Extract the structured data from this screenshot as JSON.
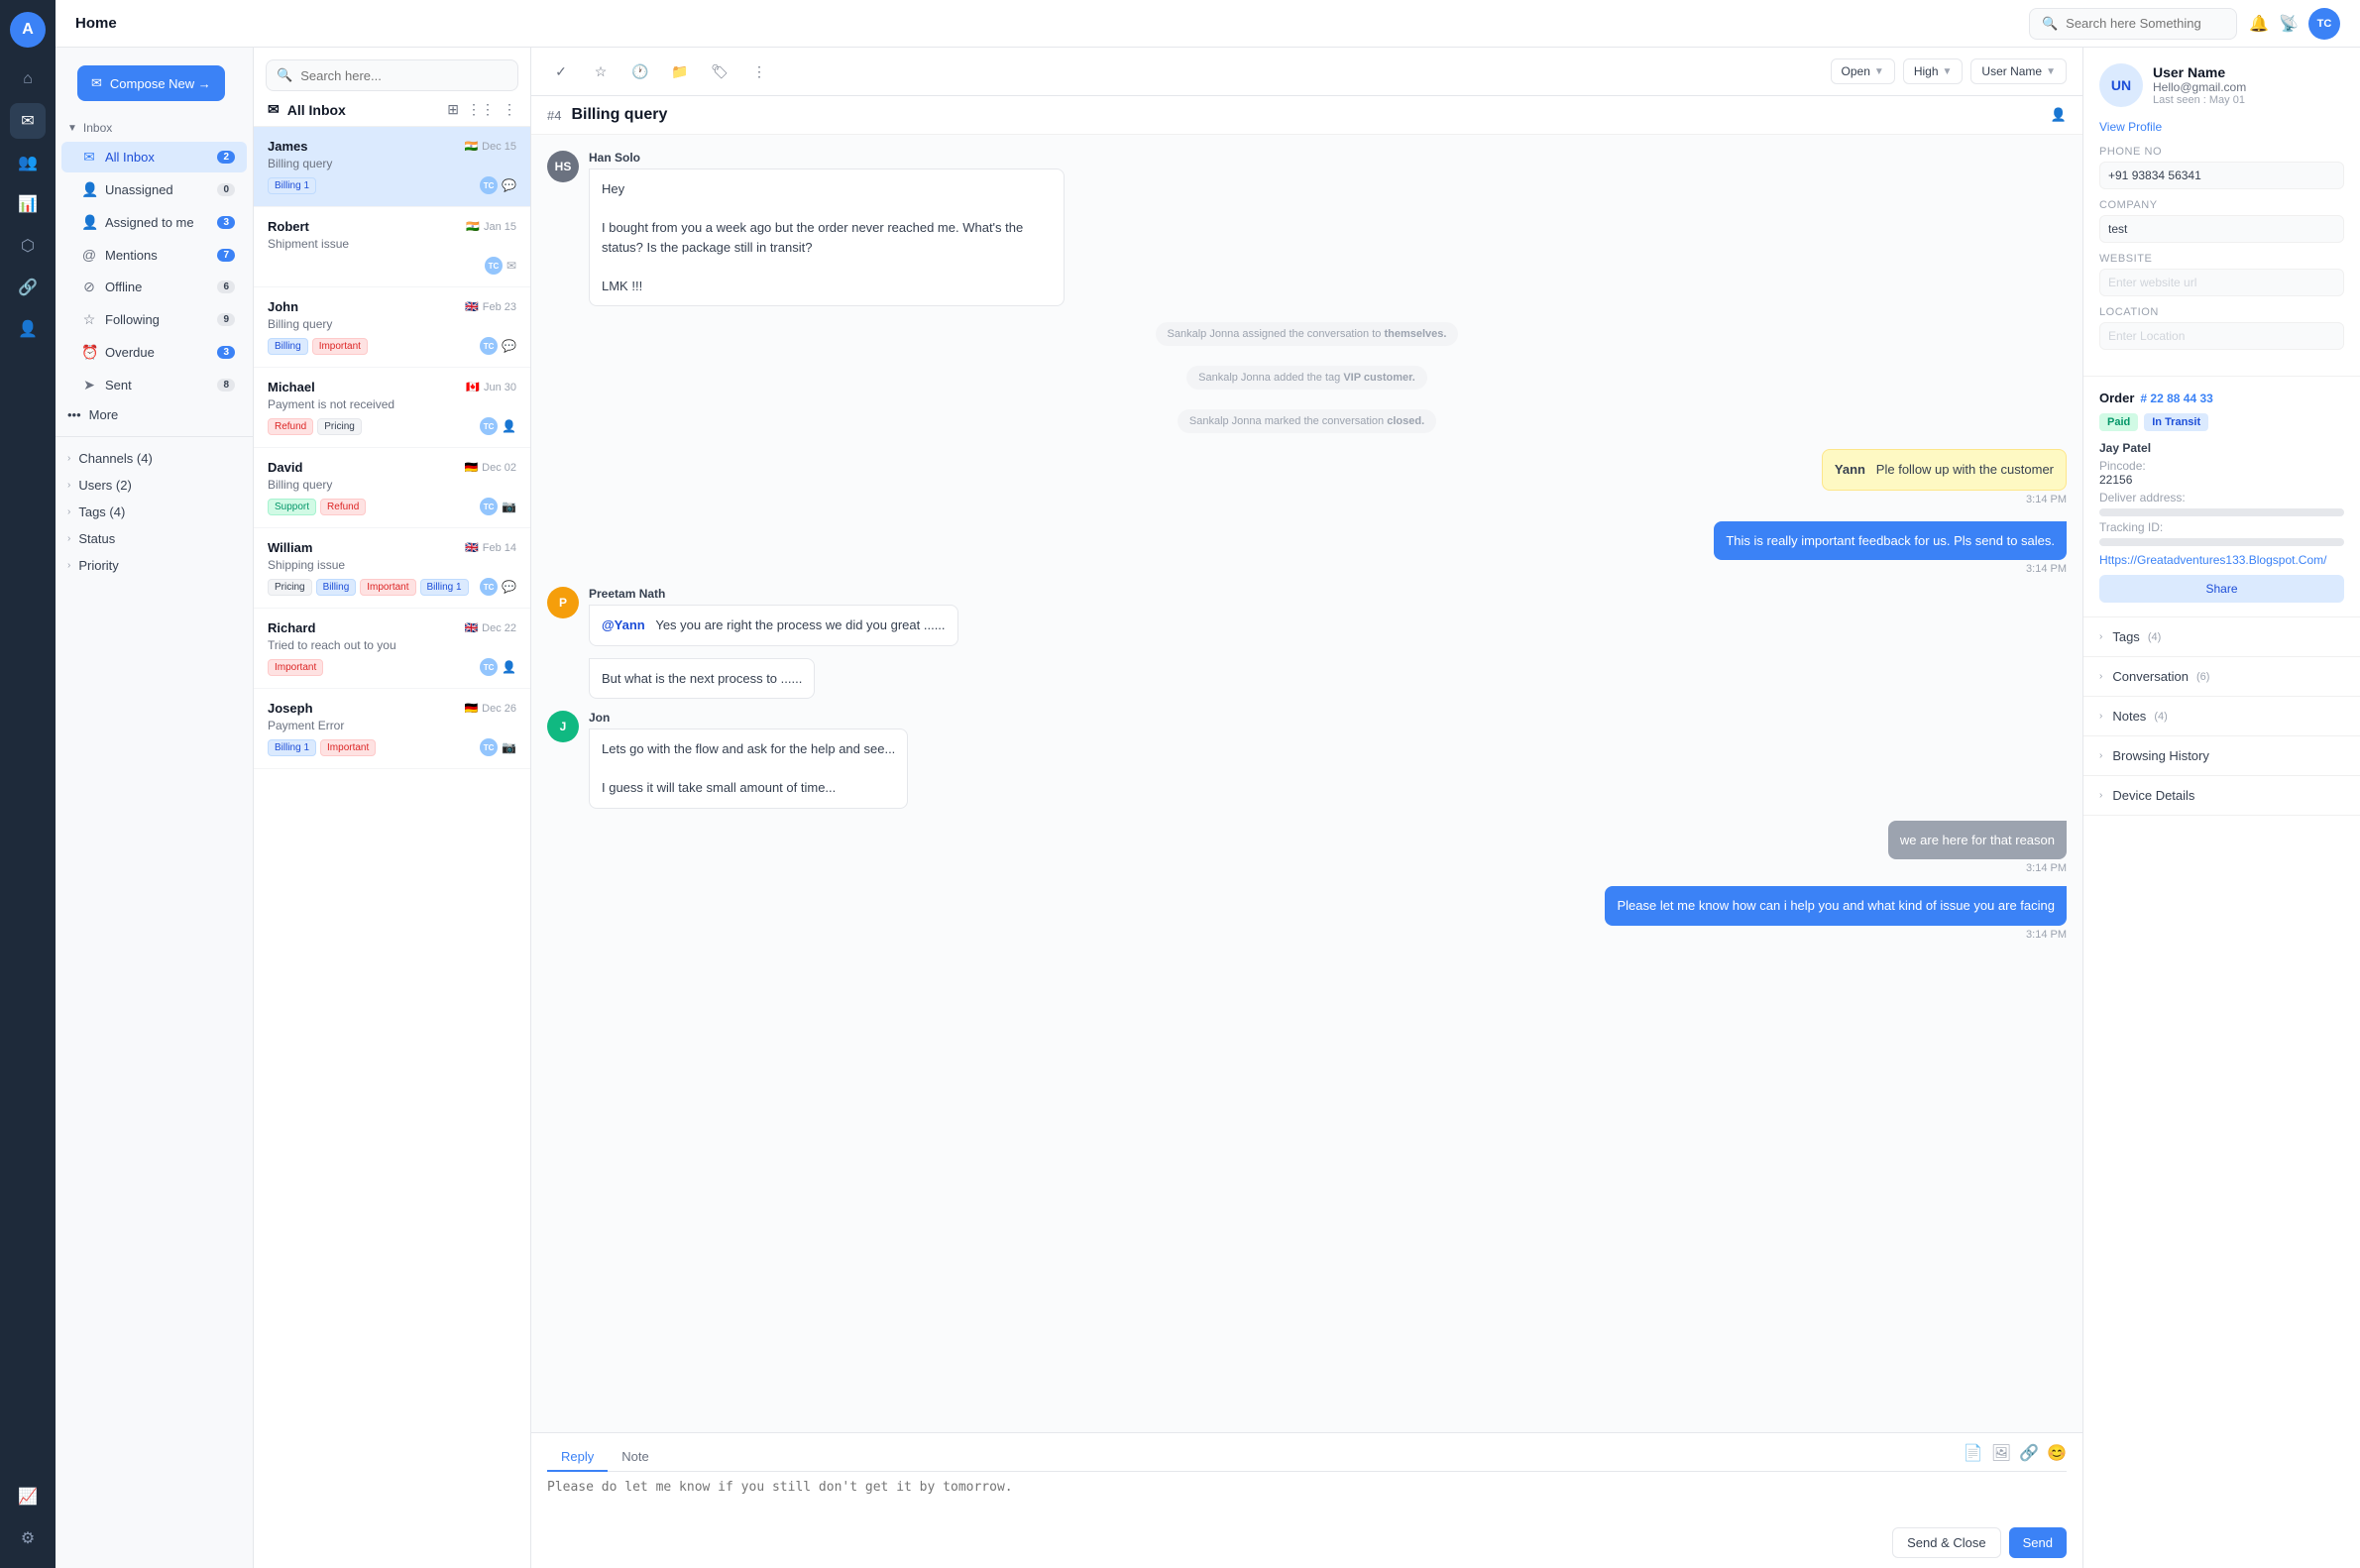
{
  "app": {
    "logo": "A",
    "header_title": "Home",
    "search_placeholder": "Search here Something",
    "user_initials": "TC"
  },
  "sidebar": {
    "compose_label": "Compose New →",
    "inbox_label": "Inbox",
    "items": [
      {
        "id": "all-inbox",
        "label": "All Inbox",
        "icon": "✉",
        "badge": "2",
        "active": true
      },
      {
        "id": "unassigned",
        "label": "Unassigned",
        "icon": "👤",
        "badge": "0",
        "active": false
      },
      {
        "id": "assigned-to-me",
        "label": "Assigned to me",
        "icon": "👤+",
        "badge": "3",
        "active": false
      },
      {
        "id": "mentions",
        "label": "Mentions",
        "icon": "@",
        "badge": "7",
        "active": false
      },
      {
        "id": "offline",
        "label": "Offline",
        "icon": "⊘",
        "badge": "6",
        "active": false
      },
      {
        "id": "following",
        "label": "Following",
        "icon": "☆",
        "badge": "9",
        "active": false
      },
      {
        "id": "overdue",
        "label": "Overdue",
        "icon": "⏰",
        "badge": "3",
        "active": false
      },
      {
        "id": "sent",
        "label": "Sent",
        "icon": "➤",
        "badge": "8",
        "active": false
      }
    ],
    "groups": [
      {
        "id": "channels",
        "label": "Channels (4)"
      },
      {
        "id": "users",
        "label": "Users (2)"
      },
      {
        "id": "tags",
        "label": "Tags (4)"
      },
      {
        "id": "status",
        "label": "Status"
      },
      {
        "id": "priority",
        "label": "Priority"
      }
    ],
    "more_label": "More"
  },
  "conv_list": {
    "search_placeholder": "Search here...",
    "title": "All Inbox",
    "conversations": [
      {
        "id": "james",
        "name": "James",
        "flag": "🇮🇳",
        "date": "Dec 15",
        "subject": "Billing query",
        "tags": [
          {
            "label": "Billing 1",
            "color": "blue"
          }
        ],
        "avatars": [
          "TC"
        ],
        "channel_icon": "💬",
        "active": true
      },
      {
        "id": "robert",
        "name": "Robert",
        "flag": "🇮🇳",
        "date": "Jan 15",
        "subject": "Shipment issue",
        "tags": [],
        "avatars": [
          "TC"
        ],
        "channel_icon": "✉",
        "active": false
      },
      {
        "id": "john",
        "name": "John",
        "flag": "🇬🇧",
        "date": "Feb 23",
        "subject": "Billing query",
        "tags": [
          {
            "label": "Billing",
            "color": "blue"
          },
          {
            "label": "Important",
            "color": "red"
          }
        ],
        "avatars": [
          "TC"
        ],
        "channel_icon": "💬",
        "active": false
      },
      {
        "id": "michael",
        "name": "Michael",
        "flag": "🇨🇦",
        "date": "Jun 30",
        "subject": "Payment is not received",
        "tags": [
          {
            "label": "Refund",
            "color": "red"
          },
          {
            "label": "Pricing",
            "color": "gray"
          }
        ],
        "avatars": [
          "TC"
        ],
        "channel_icon": "👤",
        "active": false
      },
      {
        "id": "david",
        "name": "David",
        "flag": "🇩🇪",
        "date": "Dec 02",
        "subject": "Billing query",
        "tags": [
          {
            "label": "Support",
            "color": "green"
          },
          {
            "label": "Refund",
            "color": "red"
          }
        ],
        "avatars": [
          "TC"
        ],
        "channel_icon": "📷",
        "active": false
      },
      {
        "id": "william",
        "name": "William",
        "flag": "🇬🇧",
        "date": "Feb 14",
        "subject": "Shipping issue",
        "tags": [
          {
            "label": "Pricing",
            "color": "gray"
          },
          {
            "label": "Billing",
            "color": "blue"
          },
          {
            "label": "Important",
            "color": "red"
          },
          {
            "label": "Billing 1",
            "color": "blue"
          }
        ],
        "avatars": [
          "TC"
        ],
        "channel_icon": "💬",
        "active": false
      },
      {
        "id": "richard",
        "name": "Richard",
        "flag": "🇬🇧",
        "date": "Dec 22",
        "subject": "Tried to reach out to you",
        "tags": [
          {
            "label": "Important",
            "color": "red"
          }
        ],
        "avatars": [
          "TC"
        ],
        "channel_icon": "👤",
        "active": false
      },
      {
        "id": "joseph",
        "name": "Joseph",
        "flag": "🇩🇪",
        "date": "Dec 26",
        "subject": "Payment Error",
        "tags": [
          {
            "label": "Billing 1",
            "color": "blue"
          },
          {
            "label": "Important",
            "color": "red"
          }
        ],
        "avatars": [
          "TC"
        ],
        "channel_icon": "📷",
        "active": false
      }
    ]
  },
  "chat": {
    "id": "#4",
    "title": "Billing query",
    "status": "Open",
    "priority": "High",
    "assignee": "User Name",
    "messages": [
      {
        "id": "msg1",
        "type": "incoming",
        "sender": "Han Solo",
        "initials": "HS",
        "avatar_color": "#6b7280",
        "content": "Hey\n\nI bought from you a week ago but the order never reached me. What's the status? Is the package still in transit?\n\nLMK !!!"
      },
      {
        "id": "sys1",
        "type": "system",
        "content": "Sankalp Jonna assigned the conversation to themselves."
      },
      {
        "id": "sys2",
        "type": "system",
        "content": "Sankalp Jonna added the tag VIP customer."
      },
      {
        "id": "sys3",
        "type": "system",
        "content": "Sankalp Jonna marked the conversation closed."
      },
      {
        "id": "msg2",
        "type": "mention-highlight",
        "sender": "Yann",
        "content": "Ple follow up with the customer",
        "time": "3:14 PM"
      },
      {
        "id": "msg3",
        "type": "outgoing",
        "content": "This is really important feedback for us. Pls send to sales.",
        "time": "3:14 PM"
      },
      {
        "id": "msg4",
        "type": "incoming",
        "sender": "Preetam Nath",
        "initials": "P",
        "avatar_color": "#f59e0b",
        "content": "@Yann  Yes you are right the process we did you great ......",
        "mention": "@Yann"
      },
      {
        "id": "msg5",
        "type": "incoming-plain",
        "content": "But what is the next process to ......"
      },
      {
        "id": "msg6",
        "type": "incoming",
        "sender": "Jon",
        "initials": "J",
        "avatar_color": "#10b981",
        "content": "Lets go with the flow and ask for the help and see...\n\nI guess it will take small amount of time..."
      },
      {
        "id": "msg7",
        "type": "outgoing",
        "content": "we are here for that reason",
        "time": "3:14 PM"
      },
      {
        "id": "msg8",
        "type": "outgoing",
        "content": "Please let me know how can i help you and what kind of issue you are facing",
        "time": "3:14 PM"
      }
    ],
    "reply_placeholder": "Please do let me know if you still don't get it by tomorrow.",
    "reply_tab": "Reply",
    "note_tab": "Note",
    "send_close_label": "Send & Close",
    "send_label": "Send"
  },
  "right_panel": {
    "user": {
      "initials": "UN",
      "name": "User Name",
      "email": "Hello@gmail.com",
      "last_seen": "Last seen : May 01",
      "view_profile": "View Profile"
    },
    "phone_label": "Phone No",
    "phone_value": "+91 93834 56341",
    "company_label": "Company",
    "company_value": "test",
    "website_label": "Website",
    "website_placeholder": "Enter website url",
    "location_label": "Location",
    "location_placeholder": "Enter Location",
    "order": {
      "label": "Order",
      "number": "# 22 88 44 33",
      "badge_paid": "Paid",
      "badge_transit": "In Transit",
      "customer_name": "Jay Patel",
      "pincode_label": "Pincode:",
      "pincode_value": "22156",
      "deliver_label": "Deliver address:",
      "tracking_label": "Tracking ID:",
      "link": "Https://Greatadventures133.Blogspot.Com/",
      "share_label": "Share"
    },
    "sections": [
      {
        "id": "tags",
        "label": "Tags",
        "count": "(4)"
      },
      {
        "id": "conversation",
        "label": "Conversation",
        "count": "(6)"
      },
      {
        "id": "notes",
        "label": "Notes",
        "count": "(4)"
      },
      {
        "id": "browsing-history",
        "label": "Browsing History",
        "count": ""
      },
      {
        "id": "device-details",
        "label": "Device Details",
        "count": ""
      }
    ]
  },
  "nav_icons": [
    {
      "id": "home",
      "icon": "⌂",
      "active": false
    },
    {
      "id": "inbox",
      "icon": "✉",
      "active": true
    },
    {
      "id": "contacts",
      "icon": "👥",
      "active": false
    },
    {
      "id": "reports",
      "icon": "📊",
      "active": false
    },
    {
      "id": "settings-nav",
      "icon": "⚙",
      "active": false
    }
  ]
}
